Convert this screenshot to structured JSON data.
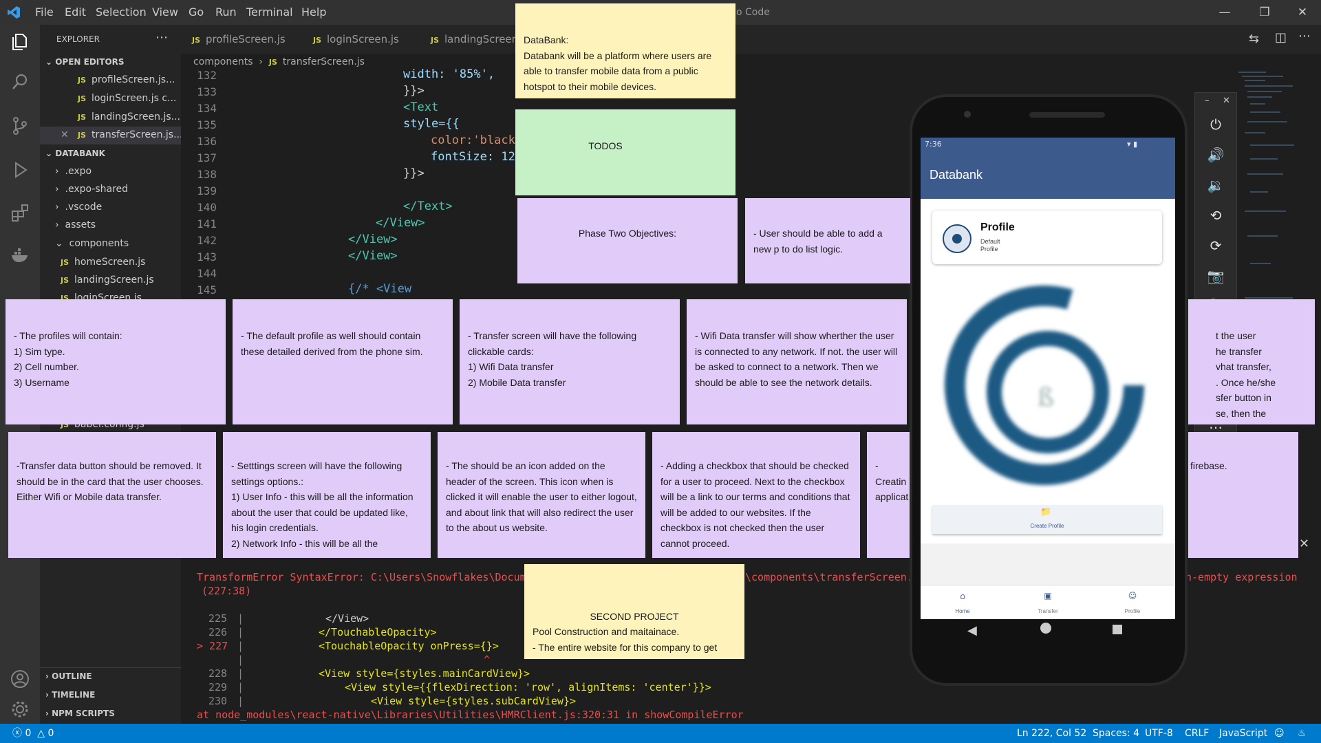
{
  "titlebar": {
    "menu": [
      "File",
      "Edit",
      "Selection",
      "View",
      "Go",
      "Run",
      "Terminal",
      "Help"
    ],
    "title_suffix": "o Code"
  },
  "explorer": {
    "header": "EXPLORER",
    "open_editors_label": "OPEN EDITORS",
    "open_editors": [
      "profileScreen.js...",
      "loginScreen.js  c...",
      "landingScreen.js...",
      "transferScreen.js..."
    ],
    "project_label": "DATABANK",
    "folders": [
      ".expo",
      ".expo-shared",
      ".vscode",
      "assets",
      "components"
    ],
    "component_files": [
      "homeScreen.js",
      "landingScreen.js",
      "loginScreen.js"
    ],
    "babel_file": "babel.config.js",
    "outline_label": "OUTLINE",
    "timeline_label": "TIMELINE",
    "npm_label": "NPM SCRIPTS"
  },
  "tabs": [
    "profileScreen.js",
    "loginScreen.js",
    "landingScreen"
  ],
  "breadcrumb": {
    "folder": "components",
    "file": "transferScreen.js"
  },
  "editor": {
    "line_numbers": [
      "132",
      "133",
      "134",
      "135",
      "136",
      "137",
      "138",
      "139",
      "140",
      "141",
      "142",
      "143",
      "144",
      "145"
    ],
    "lines": [
      "width: '85%',",
      "}}>",
      "<Text",
      "style={{",
      "color:'black",
      "fontSize: 12",
      "}}>",
      "",
      "</Text>",
      "</View>",
      "</View>",
      "</View>",
      "",
      "{/* <View"
    ]
  },
  "terminal": {
    "error_line1_a": "TransformError SyntaxError: C:\\Users\\Snowflakes\\Docum",
    "error_line1_b": "\\components\\transferScreen.",
    "error_line1_c": "n-empty expression",
    "error_line2": "(227:38)",
    "line_numbers": [
      "225",
      "226",
      "> 227",
      "",
      "228",
      "229",
      "230"
    ],
    "lines": [
      "</View>",
      "</TouchableOpacity>",
      "<TouchableOpacity onPress={}>",
      "^",
      "<View style={styles.mainCardView}>",
      "<View style={{flexDirection: 'row', alignItems: 'center'}}>",
      "<View style={styles.subCardView}>"
    ],
    "stack": "at node_modules\\react-native\\Libraries\\Utilities\\HMRClient.js:320:31 in showCompileError"
  },
  "statusbar": {
    "errors": "0",
    "warnings": "0",
    "position": "Ln 222, Col 52",
    "spaces": "Spaces: 4",
    "encoding": "UTF-8",
    "eol": "CRLF",
    "language": "JavaScript"
  },
  "notes": {
    "databank": "DataBank:\nDatabank will be a platform where users are able to transfer mobile data from a public hotspot to their mobile devices.",
    "todos": "TODOS",
    "phase_two": "Phase Two Objectives:",
    "todo_logic": "- User should be able to add a new p to do list logic.",
    "profiles": "- The profiles will contain:\n1) Sim type.\n2) Cell number.\n3) Username",
    "default_profile": "- The default profile as well should contain these detailed derived from the phone sim.",
    "transfer_screen": "- Transfer screen will have the following clickable cards:\n1) Wifi Data transfer\n2) Mobile Data transfer",
    "wifi": "- Wifi Data transfer will show wherther the user is connected to any network. If not. the user will be asked to connect to a network. Then we should be able to see the network details.",
    "partial_right": "t the user\nhe transfer\nvhat transfer,\n. Once he/she\nsfer button in\nse, then the",
    "transfer_button": "-Transfer data button should be removed. It should be in the card that the user chooses. Either Wifi or Mobile data transfer.",
    "settings": "- Setttings screen will have the following settings options.:\n1) User Info - this will be all the information about the user that could be updated like, his login credentials.\n2) Network Info - this will be all the",
    "icon": "- The should be an icon added on the header of the screen. This icon when is clicked it will enable the user to either logout, and about link that will also redirect the user to the about us website.",
    "checkbox": "- Adding a checkbox that should be checked for a user to proceed. Next to the checkbox will be a link to our terms and conditions that will be added to our websites. If the checkbox is not checked then the user cannot proceed.",
    "creating": "- Creatin\napplicat",
    "firebase": "firebase.",
    "second_project": "SECOND PROJECT\nPool Construction and maitainace.\n- The entire website for this company to get thier name out there."
  },
  "phone": {
    "time": "7:36",
    "app_title": "Databank",
    "profile_title": "Profile",
    "profile_sub1": "Default",
    "profile_sub2": "Profile",
    "create_profile": "Create Profile",
    "nav": [
      "Home",
      "Transfer",
      "Profile"
    ],
    "header_color": "#3d5a8c",
    "logo_color": "#1e5a84"
  },
  "colors": {
    "note_purple": "#e1cbf8",
    "note_yellow": "#fef3bb",
    "note_green": "#c6f0c6",
    "status_blue": "#007acc"
  }
}
